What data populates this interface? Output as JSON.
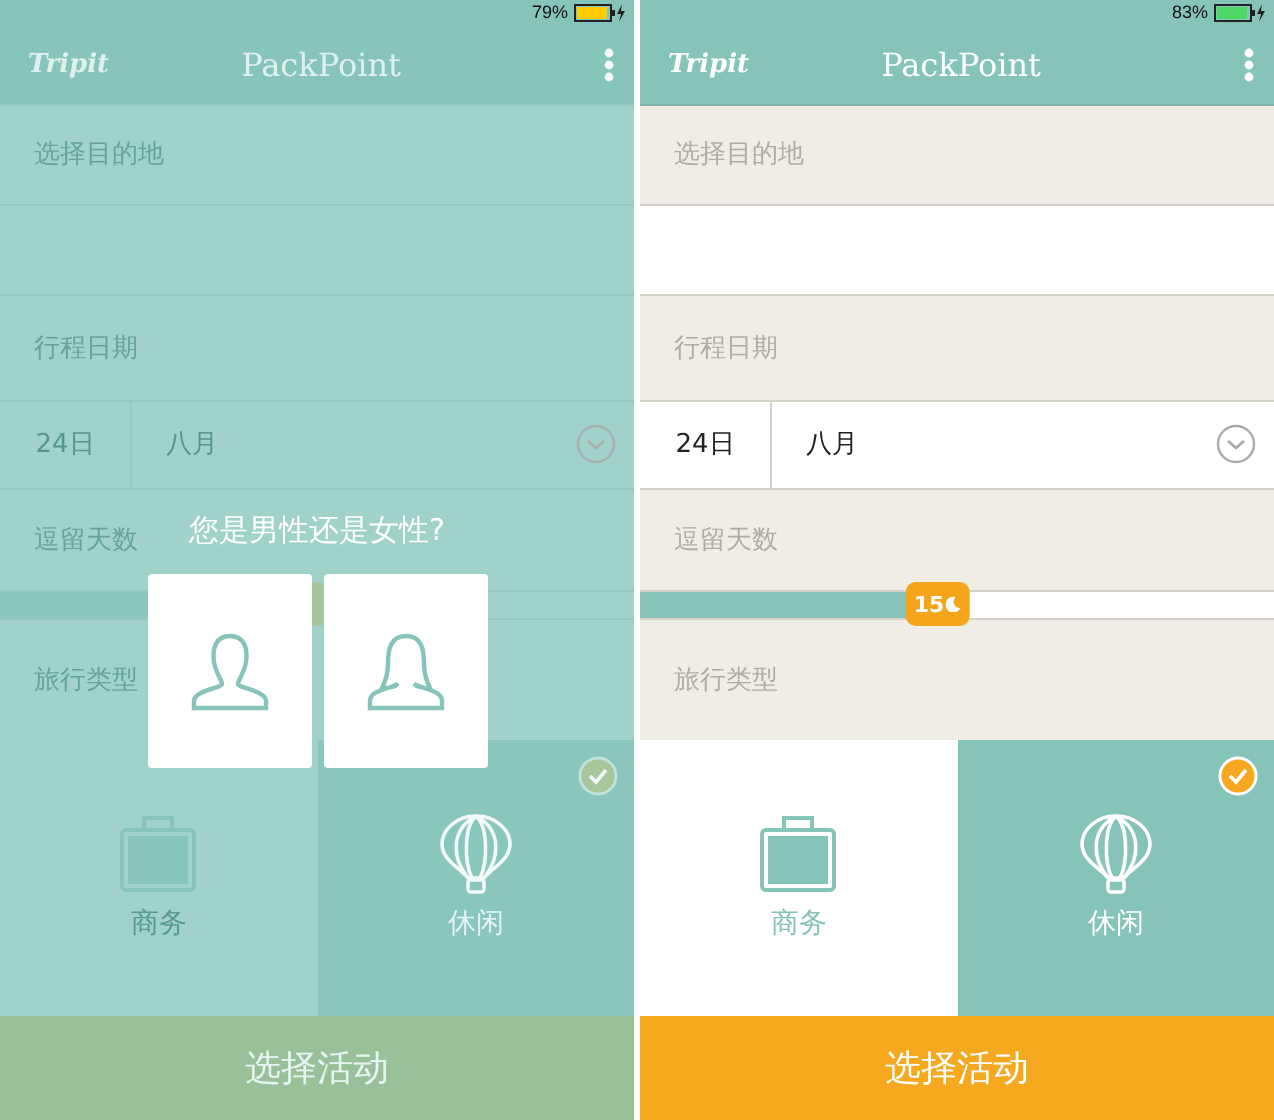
{
  "screens": [
    {
      "status": {
        "battery": "79%",
        "low_power_mode": true
      },
      "header": {
        "logo": "Tripit",
        "title": "PackPoint"
      },
      "destination": {
        "label": "选择目的地"
      },
      "dates": {
        "label": "行程日期",
        "day": "24日",
        "month": "八月"
      },
      "stay": {
        "label": "逗留天数",
        "level": 0.47
      },
      "trip_type": {
        "label": "旅行类型"
      },
      "activities": [
        {
          "label": "商务",
          "kind": "business",
          "selected": false
        },
        {
          "label": "休闲",
          "kind": "leisure",
          "selected": true
        }
      ],
      "action": "选择活动",
      "dimmed": true,
      "dialog": {
        "question": "您是男性还是女性?",
        "options": [
          {
            "kind": "male"
          },
          {
            "kind": "female"
          }
        ]
      }
    },
    {
      "status": {
        "battery": "83%",
        "low_power_mode": false
      },
      "header": {
        "logo": "Tripit",
        "title": "PackPoint"
      },
      "destination": {
        "label": "选择目的地"
      },
      "dates": {
        "label": "行程日期",
        "day": "24日",
        "month": "八月"
      },
      "stay": {
        "label": "逗留天数",
        "level": 0.47,
        "thumb": "15"
      },
      "trip_type": {
        "label": "旅行类型"
      },
      "activities": [
        {
          "label": "商务",
          "kind": "business",
          "selected": false
        },
        {
          "label": "休闲",
          "kind": "leisure",
          "selected": true
        }
      ],
      "action": "选择活动",
      "dimmed": false
    }
  ]
}
